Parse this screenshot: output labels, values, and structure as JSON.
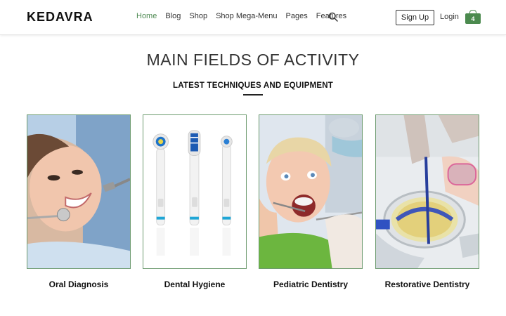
{
  "header": {
    "logo": "KEDAVRA",
    "nav": [
      "Home",
      "Blog",
      "Shop",
      "Shop Mega-Menu",
      "Pages",
      "Features"
    ],
    "active_nav": "Home",
    "signup_label": "Sign Up",
    "login_label": "Login",
    "cart_count": "4",
    "accent_color": "#4e8a52"
  },
  "section": {
    "title": "MAIN FIELDS OF ACTIVITY",
    "subtitle": "LATEST TECHNIQUES AND EQUIPMENT"
  },
  "cards": [
    {
      "label": "Oral Diagnosis",
      "image": "patient-smiling-dental-exam"
    },
    {
      "label": "Dental Hygiene",
      "image": "electric-toothbrush-heads"
    },
    {
      "label": "Pediatric Dentistry",
      "image": "child-dental-exam"
    },
    {
      "label": "Restorative Dentistry",
      "image": "dental-lab-work"
    }
  ]
}
